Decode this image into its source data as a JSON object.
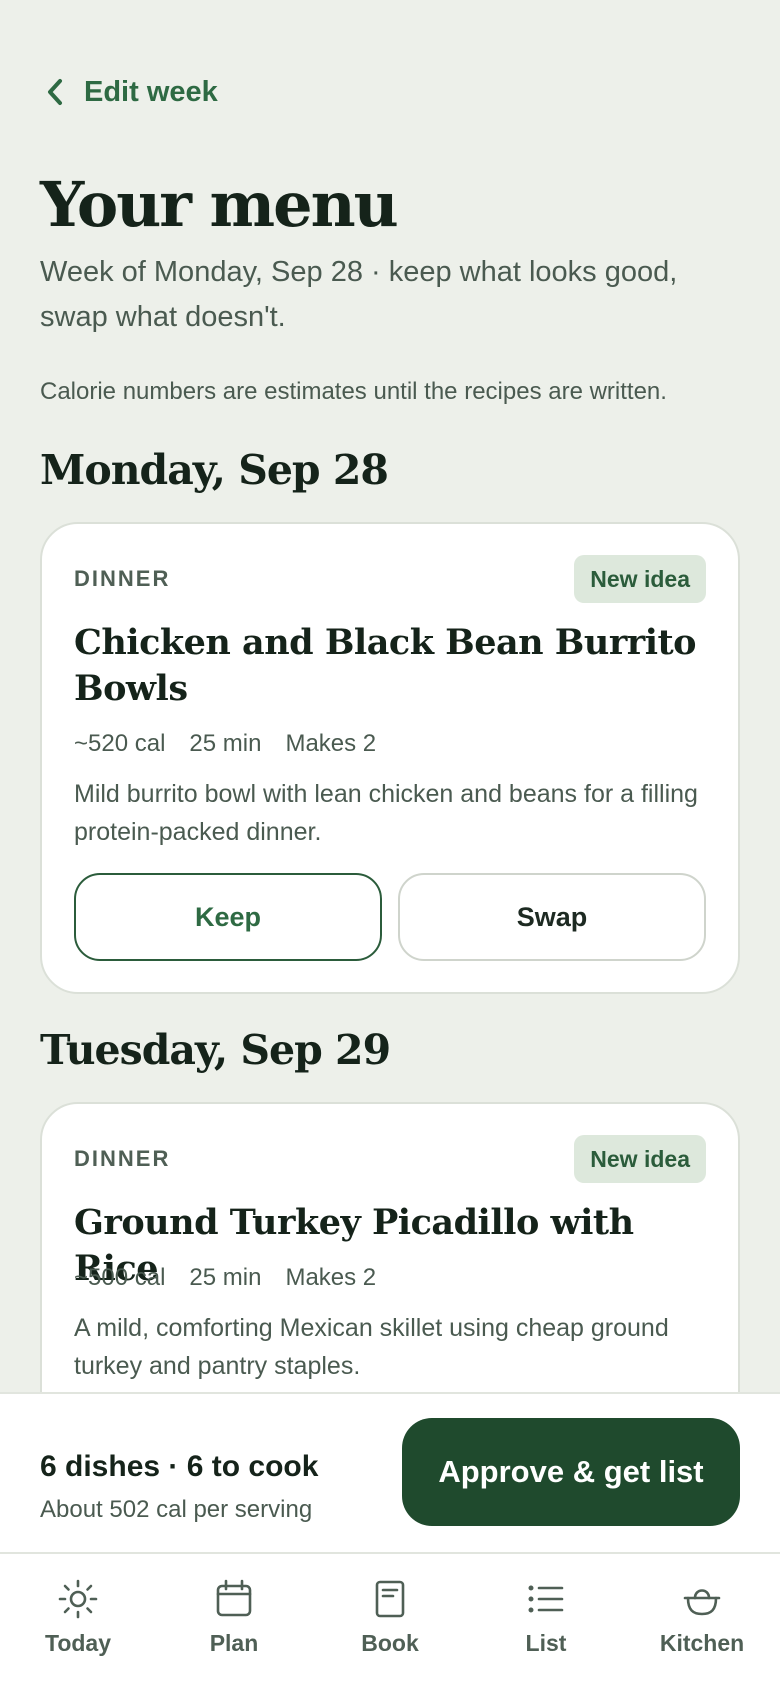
{
  "nav": {
    "back_label": "Edit week"
  },
  "header": {
    "title": "Your menu",
    "subtitle": "Week of Monday, Sep 28 · keep what looks good, swap what doesn't.",
    "note": "Calorie numbers are estimates until the recipes are written."
  },
  "days": [
    {
      "heading": "Monday, Sep 28",
      "meal_type": "DINNER",
      "badge": "New idea",
      "dish": "Chicken and Black Bean Burrito Bowls",
      "calories": "~520 cal",
      "time": "25 min",
      "servings": "Makes 2",
      "description": "Mild burrito bowl with lean chicken and beans for a filling protein-packed dinner.",
      "keep_label": "Keep",
      "swap_label": "Swap"
    },
    {
      "heading": "Tuesday, Sep 29",
      "meal_type": "DINNER",
      "badge": "New idea",
      "dish": "Ground Turkey Picadillo with Rice",
      "calories": "~500 cal",
      "time": "25 min",
      "servings": "Makes 2",
      "description": "A mild, comforting Mexican skillet using cheap ground turkey and pantry staples."
    }
  ],
  "summary": {
    "title": "6 dishes · 6 to cook",
    "subtitle": "About 502 cal per serving",
    "approve_label": "Approve & get list"
  },
  "tabs": [
    {
      "label": "Today",
      "icon": "sun-icon"
    },
    {
      "label": "Plan",
      "icon": "calendar-icon"
    },
    {
      "label": "Book",
      "icon": "book-icon"
    },
    {
      "label": "List",
      "icon": "list-icon"
    },
    {
      "label": "Kitchen",
      "icon": "pot-icon"
    }
  ],
  "colors": {
    "background": "#edf0ea",
    "accent": "#1f4a2d",
    "accent_text": "#2e6a43",
    "badge_bg": "#dde8dc"
  }
}
